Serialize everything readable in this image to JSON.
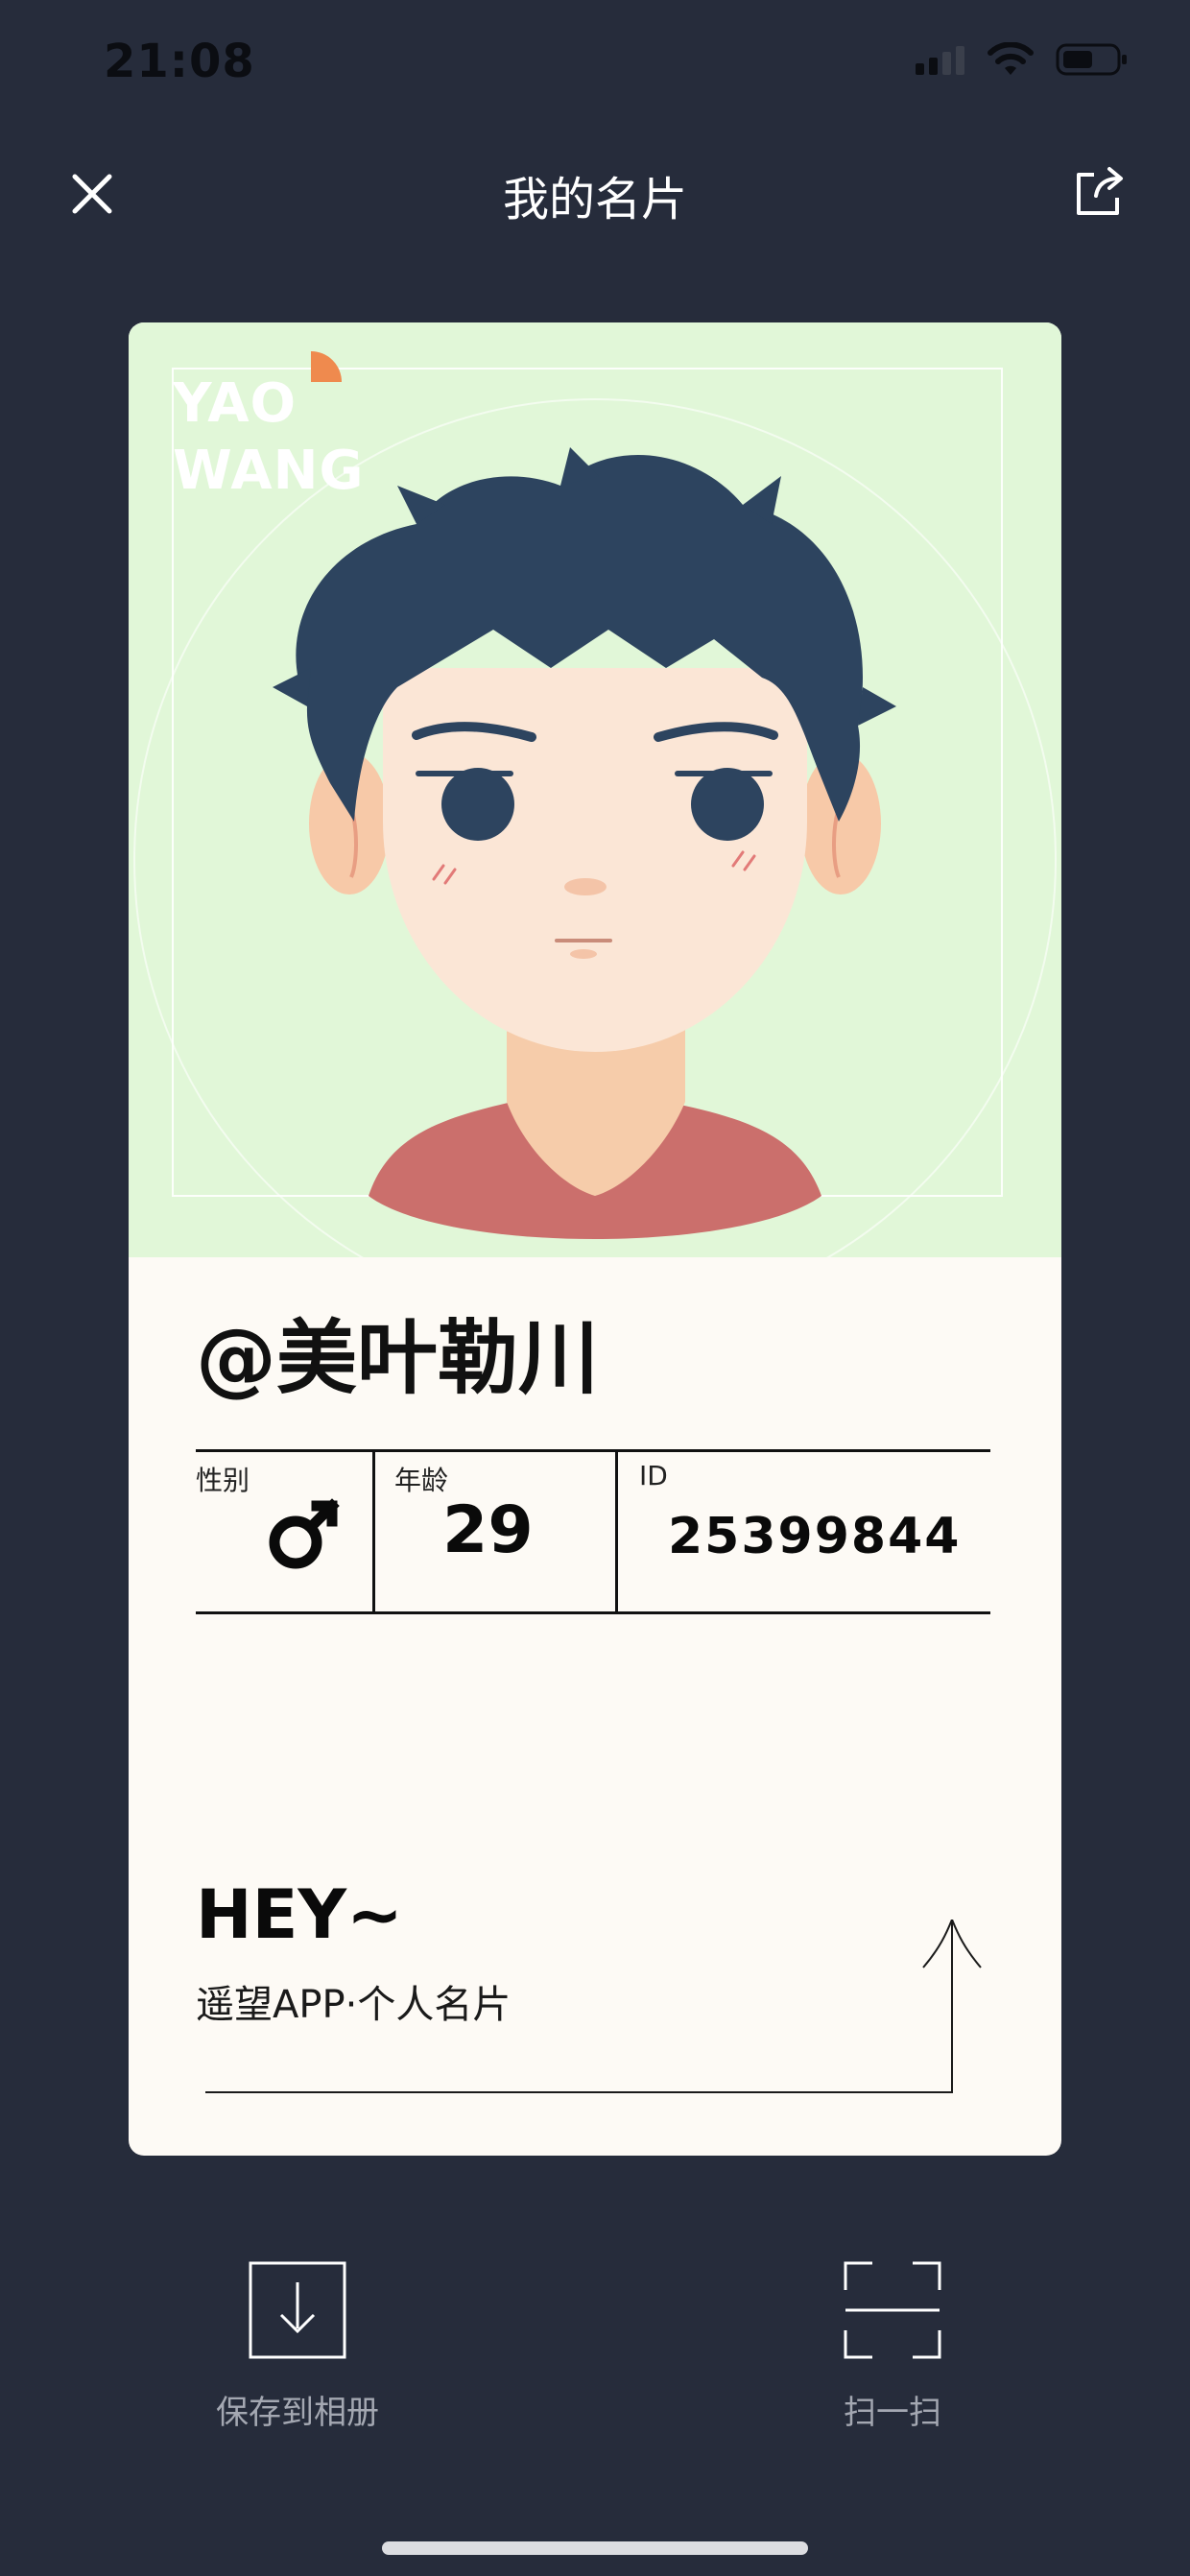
{
  "status_bar": {
    "time": "21:08"
  },
  "navbar": {
    "title": "我的名片"
  },
  "card": {
    "brand_line1": "YAO",
    "brand_line2": "WANG",
    "handle": "@美叶勒川",
    "gender": {
      "label": "性别",
      "value_icon": "male-symbol-icon"
    },
    "age": {
      "label": "年龄",
      "value": "29"
    },
    "id": {
      "label": "ID",
      "value": "25399844"
    },
    "greeting": "HEY~",
    "subtitle": "遥望APP·个人名片"
  },
  "actions": {
    "save": {
      "label": "保存到相册",
      "icon": "download-icon"
    },
    "scan": {
      "label": "扫一扫",
      "icon": "scan-icon"
    }
  },
  "colors": {
    "background": "#262c3b",
    "card_top": "#e1f7d8",
    "card_bottom": "#fdfaf5",
    "accent": "#ef8a4e",
    "shirt": "#cb6f6c",
    "hair": "#2d445f"
  }
}
